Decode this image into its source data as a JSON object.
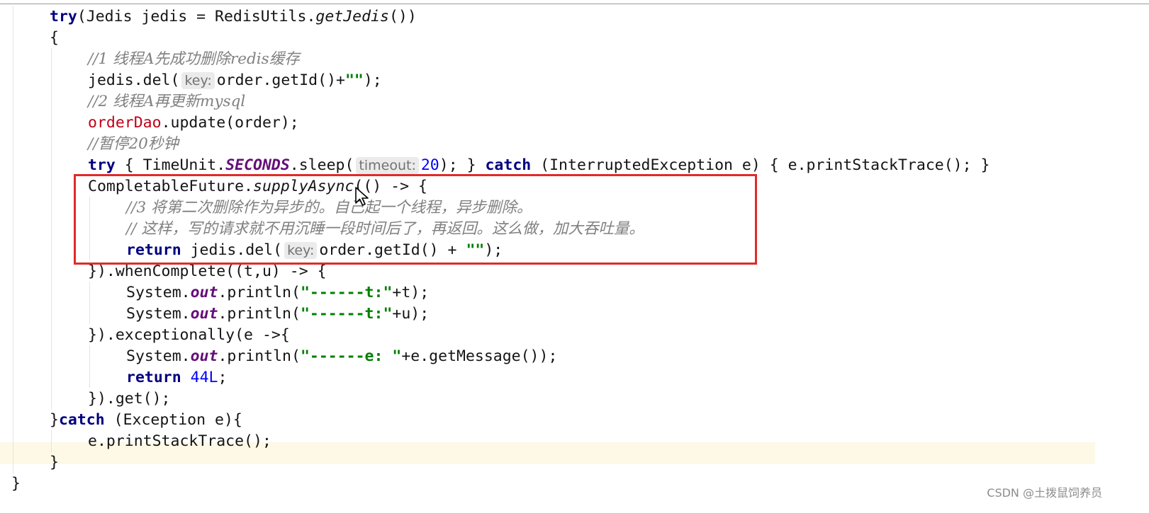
{
  "code_lines": [
    [
      {
        "t": "try",
        "c": "kw"
      },
      {
        "t": "(Jedis jedis = RedisUtils."
      },
      {
        "t": "getJedis",
        "c": "it"
      },
      {
        "t": "())"
      }
    ],
    [
      {
        "t": "{"
      }
    ],
    [
      {
        "t": "//1 线程A先成功删除redis缓存",
        "c": "cm"
      }
    ],
    [
      {
        "t": "jedis.del("
      },
      {
        "t": "key:",
        "c": "hint"
      },
      {
        "t": "order.getId()+"
      },
      {
        "t": "\"\"",
        "c": "str"
      },
      {
        "t": ");"
      }
    ],
    [
      {
        "t": "//2 线程A再更新mysql",
        "c": "cm"
      }
    ],
    [
      {
        "t": "orderDao",
        "c": "inst"
      },
      {
        "t": ".update(order);"
      }
    ],
    [
      {
        "t": "//暂停20秒钟",
        "c": "cm"
      }
    ],
    [
      {
        "t": "try",
        "c": "kw"
      },
      {
        "t": " { TimeUnit."
      },
      {
        "t": "SECONDS",
        "c": "fld"
      },
      {
        "t": ".sleep("
      },
      {
        "t": "timeout:",
        "c": "hint"
      },
      {
        "t": "20",
        "c": "num"
      },
      {
        "t": "); } "
      },
      {
        "t": "catch",
        "c": "kw"
      },
      {
        "t": " (InterruptedException e) { e.printStackTrace(); }"
      }
    ],
    [
      {
        "t": "CompletableFuture."
      },
      {
        "t": "supplyAsync",
        "c": "it"
      },
      {
        "t": "(() -> {"
      }
    ],
    [
      {
        "t": "//3 将第二次删除作为异步的。自己起一个线程，异步删除。",
        "c": "cm"
      }
    ],
    [
      {
        "t": "// 这样，写的请求就不用沉睡一段时间后了，再返回。这么做，加大吞吐量。",
        "c": "cm"
      }
    ],
    [
      {
        "t": "return",
        "c": "kw"
      },
      {
        "t": " jedis.del("
      },
      {
        "t": "key:",
        "c": "hint"
      },
      {
        "t": "order.getId() + "
      },
      {
        "t": "\"\"",
        "c": "str"
      },
      {
        "t": ");"
      }
    ],
    [
      {
        "t": "}).whenComplete((t,u) -> {"
      }
    ],
    [
      {
        "t": "System."
      },
      {
        "t": "out",
        "c": "fld"
      },
      {
        "t": ".println("
      },
      {
        "t": "\"------t:\"",
        "c": "str"
      },
      {
        "t": "+t);"
      }
    ],
    [
      {
        "t": "System."
      },
      {
        "t": "out",
        "c": "fld"
      },
      {
        "t": ".println("
      },
      {
        "t": "\"------t:\"",
        "c": "str"
      },
      {
        "t": "+u);"
      }
    ],
    [
      {
        "t": "}).exceptionally(e ->{"
      }
    ],
    [
      {
        "t": "System."
      },
      {
        "t": "out",
        "c": "fld"
      },
      {
        "t": ".println("
      },
      {
        "t": "\"------e: \"",
        "c": "str"
      },
      {
        "t": "+e.getMessage());"
      }
    ],
    [
      {
        "t": "return",
        "c": "kw"
      },
      {
        "t": " "
      },
      {
        "t": "44L",
        "c": "num"
      },
      {
        "t": ";"
      }
    ],
    [
      {
        "t": "}).get();"
      }
    ],
    [
      {
        "t": "}"
      },
      {
        "t": "catch",
        "c": "kw"
      },
      {
        "t": " (Exception e){"
      }
    ],
    [
      {
        "t": "e.printStackTrace();"
      }
    ],
    [
      {
        "t": "}"
      }
    ],
    [
      {
        "t": "}"
      }
    ]
  ],
  "watermark": "CSDN @土拨鼠饲养员",
  "colors": {
    "keyword": "#000080",
    "comment": "#808080",
    "static_field": "#660e7a",
    "string": "#008000",
    "number": "#0000ff",
    "instance_field": "#c0001a",
    "highlight_box": "#e12a2a",
    "caret_row": "#fdf9e6"
  },
  "icons": {
    "cursor": "mouse-pointer-icon"
  }
}
